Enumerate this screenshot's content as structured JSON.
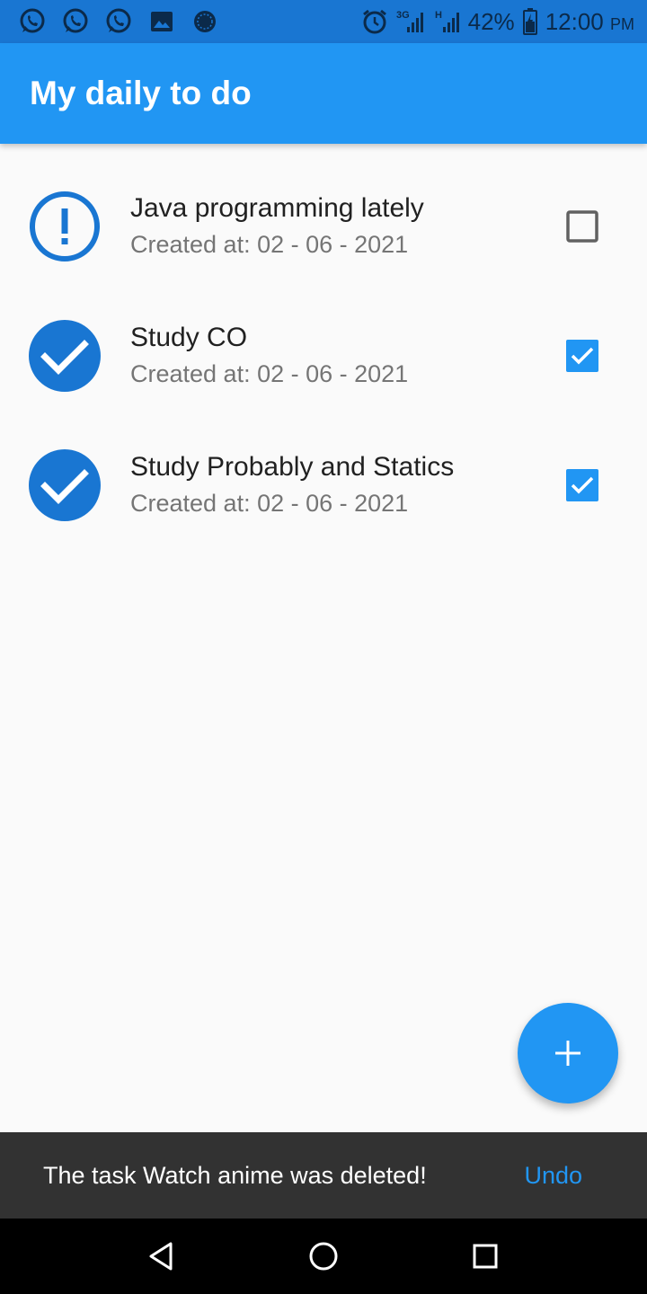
{
  "status_bar": {
    "battery": "42%",
    "time": "12:00",
    "ampm": "PM",
    "network_1": "3G",
    "network_2": "H",
    "notification_icons": [
      "whatsapp-icon",
      "whatsapp-icon",
      "whatsapp-icon",
      "gallery-icon",
      "app-icon"
    ],
    "bg_color": "#1976d2"
  },
  "app_bar": {
    "title": "My daily to do",
    "bg_color": "#2196f3"
  },
  "tasks": [
    {
      "title": "Java programming lately",
      "subtitle": "Created at: 02 - 06 - 2021",
      "status_icon": "alert-icon",
      "checked": false
    },
    {
      "title": "Study CO",
      "subtitle": "Created at: 02 - 06 - 2021",
      "status_icon": "check-circle-icon",
      "checked": true
    },
    {
      "title": "Study Probably and Statics",
      "subtitle": "Created at: 02 - 06 - 2021",
      "status_icon": "check-circle-icon",
      "checked": true
    }
  ],
  "fab": {
    "icon": "plus-icon"
  },
  "snackbar": {
    "message": "The task Watch anime was deleted!",
    "action": "Undo"
  },
  "nav_bar": {
    "buttons": [
      "back-icon",
      "home-icon",
      "recents-icon"
    ]
  },
  "colors": {
    "accent": "#2196f3",
    "accent_dark": "#1976d2",
    "snackbar_bg": "#323232"
  }
}
